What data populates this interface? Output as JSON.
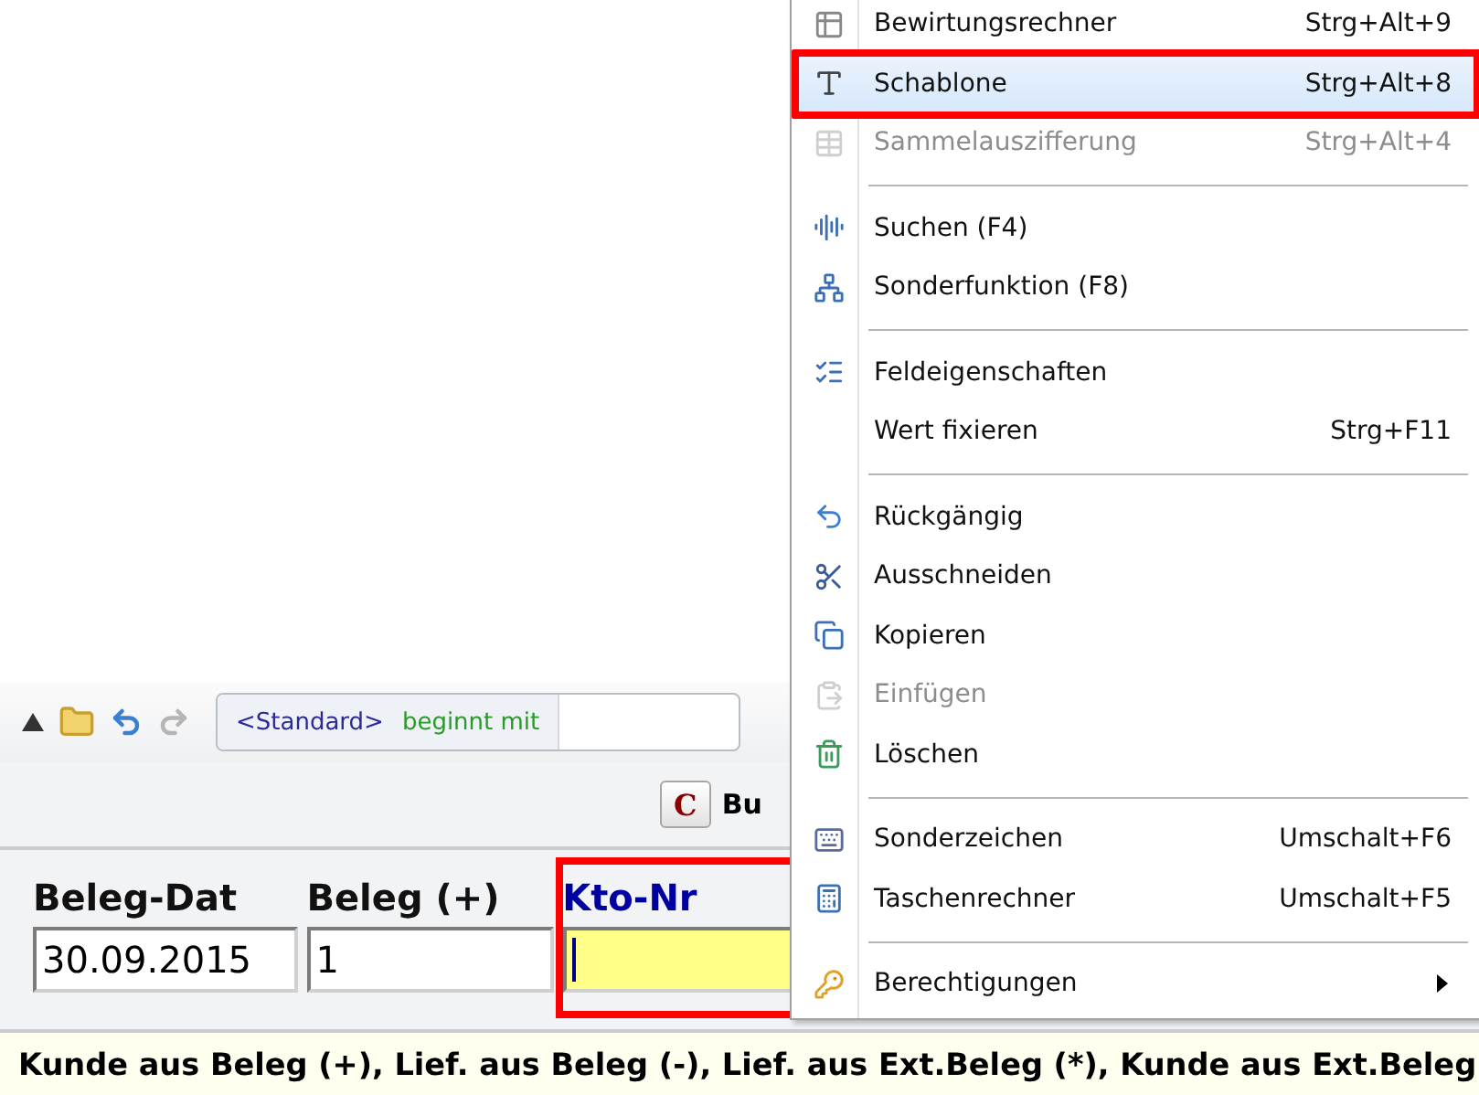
{
  "toolbar": {
    "filter_scope": "<Standard>",
    "filter_mode": "beginnt mit"
  },
  "command_bar": {
    "button_key": "C",
    "button_label": "Bu"
  },
  "form": {
    "fields": [
      {
        "label": "Beleg-Dat",
        "value": "30.09.2015",
        "focused": false
      },
      {
        "label": "Beleg (+)",
        "value": "1",
        "focused": false
      },
      {
        "label": "Kto-Nr",
        "focused": true,
        "annotated": true
      }
    ]
  },
  "status_bar": "Kunde aus Beleg (+), Lief. aus Beleg (-), Lief. aus Ext.Beleg (*), Kunde aus Ext.Beleg",
  "context_menu": {
    "items": [
      {
        "kind": "item",
        "label": "Bewirtungsrechner",
        "shortcut": "Strg+Alt+9",
        "disabled": false,
        "hovered": false,
        "annotated": false
      },
      {
        "kind": "item",
        "label": "Schablone",
        "shortcut": "Strg+Alt+8",
        "disabled": false,
        "hovered": true,
        "annotated": true
      },
      {
        "kind": "item",
        "label": "Sammelauszifferung",
        "shortcut": "Strg+Alt+4",
        "disabled": true,
        "hovered": false,
        "annotated": false
      },
      {
        "kind": "separator"
      },
      {
        "kind": "item",
        "label": "Suchen (F4)",
        "disabled": false,
        "hovered": false,
        "annotated": false
      },
      {
        "kind": "item",
        "label": "Sonderfunktion (F8)",
        "disabled": false,
        "hovered": false,
        "annotated": false
      },
      {
        "kind": "separator"
      },
      {
        "kind": "item",
        "label": "Feldeigenschaften",
        "disabled": false,
        "hovered": false,
        "annotated": false
      },
      {
        "kind": "item",
        "label": "Wert fixieren",
        "shortcut": "Strg+F11",
        "disabled": false,
        "hovered": false,
        "annotated": false
      },
      {
        "kind": "separator"
      },
      {
        "kind": "item",
        "label": "Rückgängig",
        "disabled": false,
        "hovered": false,
        "annotated": false
      },
      {
        "kind": "item",
        "label": "Ausschneiden",
        "disabled": false,
        "hovered": false,
        "annotated": false
      },
      {
        "kind": "item",
        "label": "Kopieren",
        "disabled": false,
        "hovered": false,
        "annotated": false
      },
      {
        "kind": "item",
        "label": "Einfügen",
        "disabled": true,
        "hovered": false,
        "annotated": false
      },
      {
        "kind": "item",
        "label": "Löschen",
        "disabled": false,
        "hovered": false,
        "annotated": false
      },
      {
        "kind": "separator"
      },
      {
        "kind": "item",
        "label": "Sonderzeichen",
        "shortcut": "Umschalt+F6",
        "disabled": false,
        "hovered": false,
        "annotated": false
      },
      {
        "kind": "item",
        "label": "Taschenrechner",
        "shortcut": "Umschalt+F5",
        "disabled": false,
        "hovered": false,
        "annotated": false
      },
      {
        "kind": "separator"
      },
      {
        "kind": "item",
        "label": "Berechtigungen",
        "submenu": true,
        "disabled": false,
        "hovered": false,
        "annotated": false
      }
    ]
  }
}
